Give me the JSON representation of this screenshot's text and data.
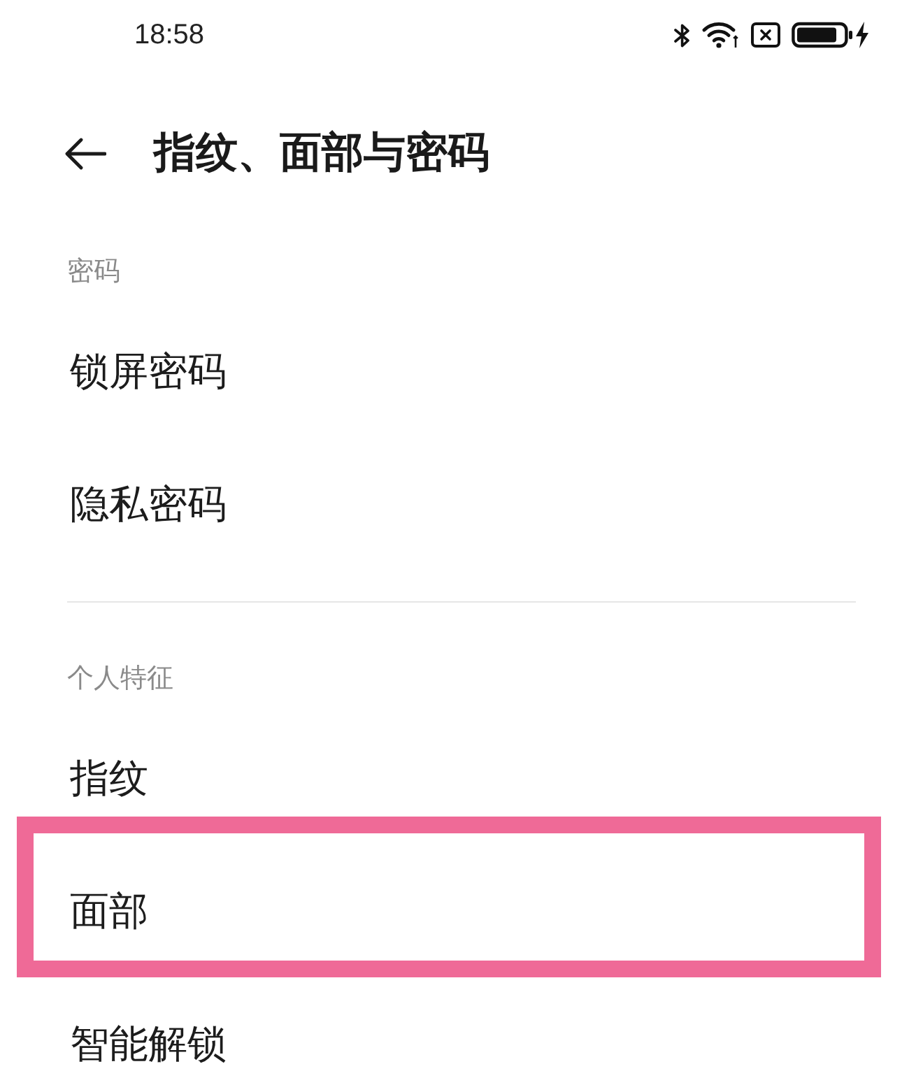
{
  "status_bar": {
    "time": "18:58"
  },
  "header": {
    "title": "指纹、面部与密码"
  },
  "sections": [
    {
      "title": "密码",
      "items": [
        {
          "label": "锁屏密码",
          "highlighted": false
        },
        {
          "label": "隐私密码",
          "highlighted": false
        }
      ]
    },
    {
      "title": "个人特征",
      "items": [
        {
          "label": "指纹",
          "highlighted": false
        },
        {
          "label": "面部",
          "highlighted": true
        },
        {
          "label": "智能解锁",
          "highlighted": false
        }
      ]
    }
  ]
}
